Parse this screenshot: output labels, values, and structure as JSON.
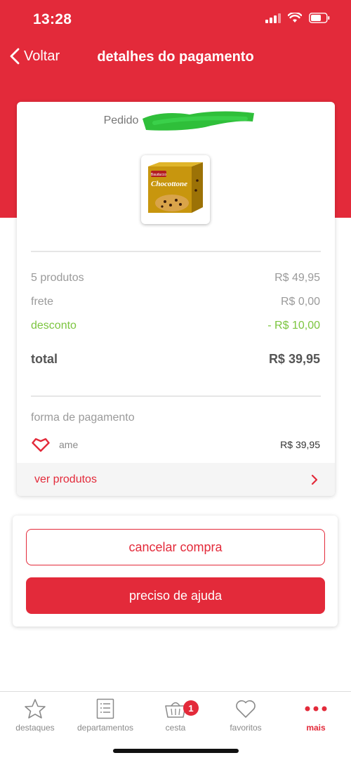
{
  "status": {
    "time": "13:28"
  },
  "nav": {
    "back_label": "Voltar",
    "title": "detalhes do pagamento"
  },
  "order": {
    "label": "Pedido"
  },
  "summary": {
    "products_label": "5 produtos",
    "products_value": "R$ 49,95",
    "shipping_label": "frete",
    "shipping_value": "R$ 0,00",
    "discount_label": "desconto",
    "discount_value": "- R$ 10,00",
    "total_label": "total",
    "total_value": "R$ 39,95"
  },
  "payment": {
    "label": "forma de pagamento",
    "method": "ame",
    "amount": "R$ 39,95"
  },
  "see_products": "ver produtos",
  "actions": {
    "cancel": "cancelar compra",
    "help": "preciso de ajuda"
  },
  "tabs": [
    {
      "label": "destaques",
      "icon": "star-icon"
    },
    {
      "label": "departamentos",
      "icon": "list-icon"
    },
    {
      "label": "cesta",
      "icon": "basket-icon",
      "badge": "1"
    },
    {
      "label": "favoritos",
      "icon": "heart-icon"
    },
    {
      "label": "mais",
      "icon": "more-dots-icon",
      "active": true
    }
  ],
  "product_image": {
    "brand": "Bauducco",
    "name": "Chocottone"
  },
  "colors": {
    "brand_red": "#e32a3a",
    "discount_green": "#7cc53f"
  }
}
